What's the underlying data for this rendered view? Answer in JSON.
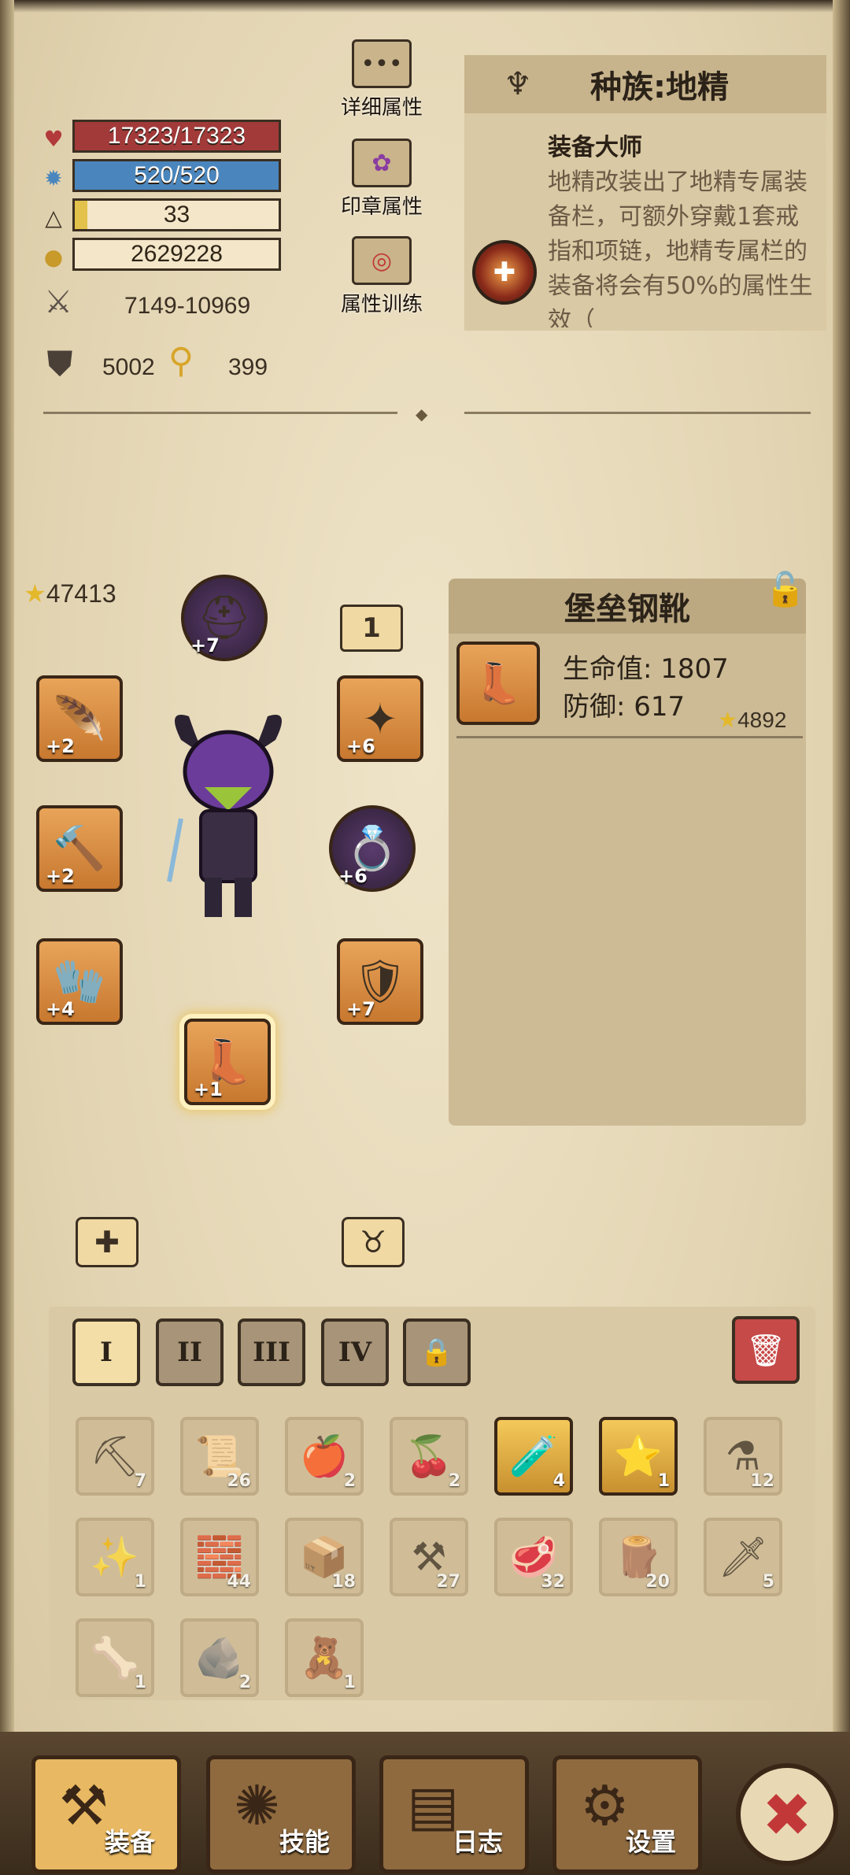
{
  "stats": {
    "hp": "17323/17323",
    "mp": "520/520",
    "level": "33",
    "level_progress": 0.06,
    "gold": "2629228",
    "attack": "7149-10969",
    "defense": "5002",
    "magic": "399"
  },
  "side_buttons": {
    "detail": "详细属性",
    "seal": "印章属性",
    "training": "属性训练"
  },
  "race": {
    "title": "种族:地精",
    "skill_name": "装备大师",
    "skill_desc": "地精改装出了地精专属装备栏，可额外穿戴1套戒指和项链，地精专属栏的装备将会有50%的属性生效（"
  },
  "equipment": {
    "score": "47413",
    "badge": "1",
    "slots": [
      {
        "name": "helmet",
        "level": "+7",
        "icon": "⛑"
      },
      {
        "name": "amulet",
        "level": "+6",
        "icon": "✦"
      },
      {
        "name": "cloak",
        "level": "+2",
        "icon": "🪶"
      },
      {
        "name": "weapon",
        "level": "+2",
        "icon": "🔨"
      },
      {
        "name": "ring",
        "level": "+6",
        "icon": "💍"
      },
      {
        "name": "gloves",
        "level": "+4",
        "icon": "🧤"
      },
      {
        "name": "armor",
        "level": "+7",
        "icon": "🛡"
      },
      {
        "name": "boots",
        "level": "+1",
        "icon": "👢"
      }
    ]
  },
  "item": {
    "title": "堡垒钢靴",
    "hp_label": "生命值: 1807",
    "def_label": "防御: 617",
    "score": "4892"
  },
  "inventory": {
    "tabs": [
      "I",
      "II",
      "III",
      "IV"
    ],
    "items": [
      {
        "icon": "⛏",
        "count": "7",
        "bright": false
      },
      {
        "icon": "📜",
        "count": "26",
        "bright": false
      },
      {
        "icon": "🍎",
        "count": "2",
        "bright": false
      },
      {
        "icon": "🍒",
        "count": "2",
        "bright": false
      },
      {
        "icon": "🧪",
        "count": "4",
        "bright": true
      },
      {
        "icon": "⭐",
        "count": "1",
        "bright": true
      },
      {
        "icon": "⚗",
        "count": "12",
        "bright": false
      },
      {
        "icon": "✨",
        "count": "1",
        "bright": false
      },
      {
        "icon": "🧱",
        "count": "44",
        "bright": false
      },
      {
        "icon": "📦",
        "count": "18",
        "bright": false
      },
      {
        "icon": "⚒",
        "count": "27",
        "bright": false
      },
      {
        "icon": "🥩",
        "count": "32",
        "bright": false
      },
      {
        "icon": "🪵",
        "count": "20",
        "bright": false
      },
      {
        "icon": "🗡",
        "count": "5",
        "bright": false
      },
      {
        "icon": "🦴",
        "count": "1",
        "bright": false
      },
      {
        "icon": "🪨",
        "count": "2",
        "bright": false
      },
      {
        "icon": "🧸",
        "count": "1",
        "bright": false
      }
    ]
  },
  "nav": {
    "equip": "装备",
    "skills": "技能",
    "log": "日志",
    "settings": "设置"
  },
  "colors": {
    "hp": "#a23a3a",
    "mp": "#4a86bd",
    "close": "#c23838"
  }
}
